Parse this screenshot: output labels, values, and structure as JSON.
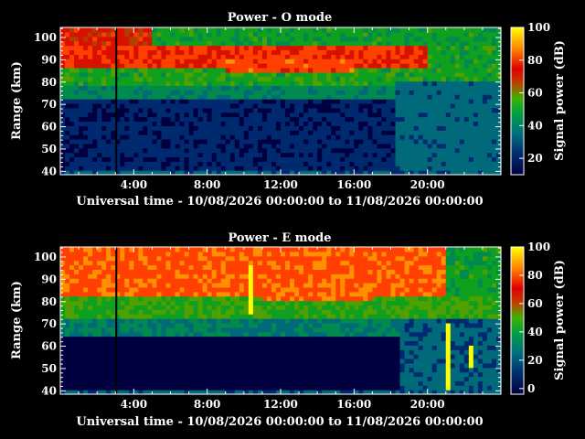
{
  "chart_data": [
    {
      "type": "heatmap",
      "title": "Power - O mode",
      "xlabel": "Universal time - 10/08/2026 00:00:00 to 11/08/2026 00:00:00",
      "ylabel": "Range (km)",
      "colorbar_label": "Signal power (dB)",
      "xlim": [
        0,
        24
      ],
      "ylim": [
        38.5,
        104.5
      ],
      "clim": [
        10,
        100
      ],
      "x_ticks": [
        "4:00",
        "8:00",
        "12:00",
        "16:00",
        "20:00"
      ],
      "x_tick_values": [
        4,
        8,
        12,
        16,
        20
      ],
      "y_ticks": [
        "40",
        "50",
        "60",
        "70",
        "80",
        "90",
        "100"
      ],
      "y_tick_values": [
        40,
        50,
        60,
        70,
        80,
        90,
        100
      ],
      "colorbar_ticks": [
        "20",
        "40",
        "60",
        "80",
        "100"
      ],
      "colorbar_tick_values": [
        20,
        40,
        60,
        80,
        100
      ],
      "dataset_label": "power-o",
      "bands": [
        {
          "range_km": [
            40,
            72
          ],
          "time_h": [
            0,
            18.3
          ],
          "signal_db": 12
        },
        {
          "range_km": [
            72,
            78
          ],
          "time_h": [
            0,
            18.3
          ],
          "signal_db": 32
        },
        {
          "range_km": [
            78,
            86
          ],
          "time_h": [
            0,
            24
          ],
          "signal_db": 42
        },
        {
          "range_km": [
            86,
            96
          ],
          "time_h": [
            0,
            20
          ],
          "signal_db": 62
        },
        {
          "range_km": [
            96,
            104
          ],
          "time_h": [
            0,
            5
          ],
          "signal_db": 58
        }
      ],
      "features": [
        {
          "name": "red-layer-ridge",
          "time_h": [
            9,
            16
          ],
          "range_km": [
            84,
            90
          ],
          "signal_db": 66
        },
        {
          "name": "data-gap",
          "time_h": [
            3.0,
            3.1
          ],
          "range_km": [
            40,
            104
          ],
          "signal_db": null
        },
        {
          "name": "night-time-echoes",
          "time_h": [
            18.3,
            24
          ],
          "range_km": [
            40,
            80
          ],
          "signal_db": 24
        }
      ]
    },
    {
      "type": "heatmap",
      "title": "Power - E mode",
      "xlabel": "Universal time - 10/08/2026 00:00:00 to 11/08/2026 00:00:00",
      "ylabel": "Range (km)",
      "colorbar_label": "Signal power (dB)",
      "xlim": [
        0,
        24
      ],
      "ylim": [
        38.5,
        104.5
      ],
      "clim": [
        -4,
        100
      ],
      "x_ticks": [
        "4:00",
        "8:00",
        "12:00",
        "16:00",
        "20:00"
      ],
      "x_tick_values": [
        4,
        8,
        12,
        16,
        20
      ],
      "y_ticks": [
        "40",
        "50",
        "60",
        "70",
        "80",
        "90",
        "100"
      ],
      "y_tick_values": [
        40,
        50,
        60,
        70,
        80,
        90,
        100
      ],
      "colorbar_ticks": [
        "0",
        "20",
        "40",
        "60",
        "80",
        "100"
      ],
      "colorbar_tick_values": [
        0,
        20,
        40,
        60,
        80,
        100
      ],
      "dataset_label": "power-e",
      "bands": [
        {
          "range_km": [
            40,
            64
          ],
          "time_h": [
            0,
            18.5
          ],
          "signal_db": 5
        },
        {
          "range_km": [
            64,
            72
          ],
          "time_h": [
            0,
            18.5
          ],
          "signal_db": 30
        },
        {
          "range_km": [
            72,
            82
          ],
          "time_h": [
            0,
            24
          ],
          "signal_db": 44
        },
        {
          "range_km": [
            82,
            104
          ],
          "time_h": [
            0,
            21
          ],
          "signal_db": 68
        }
      ],
      "features": [
        {
          "name": "red-layer-ridge",
          "time_h": [
            11,
            17
          ],
          "range_km": [
            80,
            88
          ],
          "signal_db": 70
        },
        {
          "name": "data-gap",
          "time_h": [
            3.0,
            3.1
          ],
          "range_km": [
            40,
            104
          ],
          "signal_db": null
        },
        {
          "name": "interference-spike",
          "time_h": [
            10.3,
            10.6
          ],
          "range_km": [
            74,
            96
          ],
          "signal_db": 100
        },
        {
          "name": "interference-spike",
          "time_h": [
            21.1,
            21.3
          ],
          "range_km": [
            40,
            70
          ],
          "signal_db": 100
        },
        {
          "name": "interference-spike",
          "time_h": [
            22.3,
            22.5
          ],
          "range_km": [
            50,
            60
          ],
          "signal_db": 100
        }
      ]
    }
  ]
}
